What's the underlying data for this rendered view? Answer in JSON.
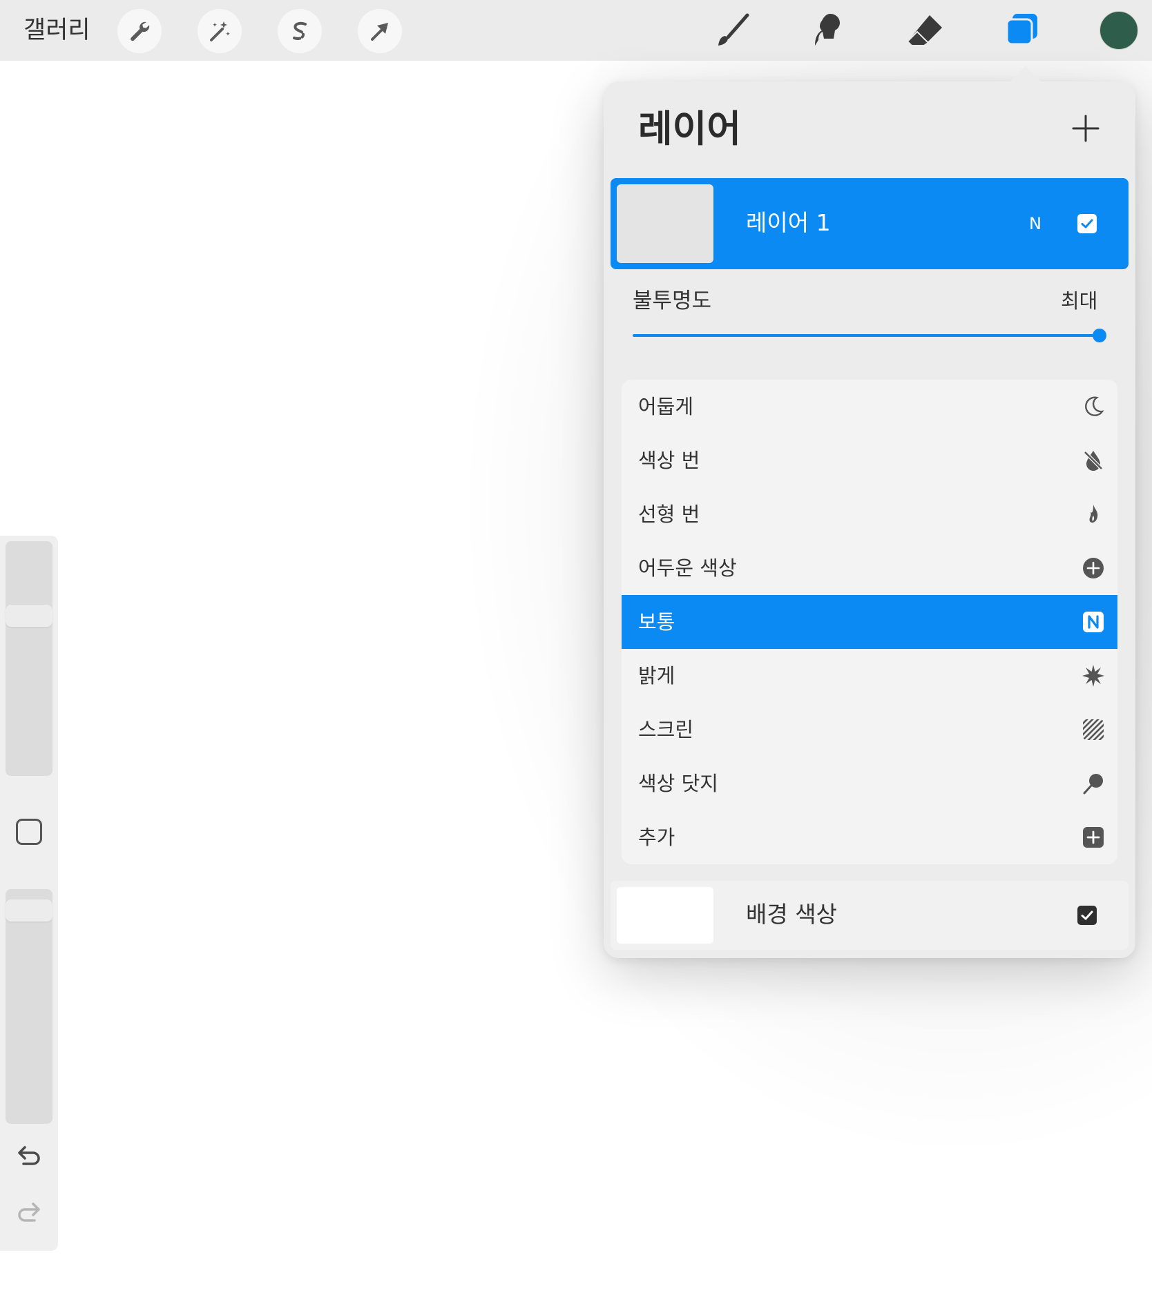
{
  "toolbar": {
    "gallery_label": "갤러리",
    "left_tools": [
      "wrench-icon",
      "magic-wand-icon",
      "selection-s-icon",
      "transform-arrow-icon"
    ],
    "right_tools": [
      "brush-icon",
      "smudge-icon",
      "eraser-icon",
      "layers-icon"
    ],
    "active_tool": "layers-icon",
    "current_color": "#2e5e4b"
  },
  "sidebar": {
    "brush_size_level": 0.7,
    "opacity_level": 0.95,
    "icons": [
      "modify-square-icon",
      "undo-icon",
      "redo-icon"
    ]
  },
  "layers_panel": {
    "title": "레이어",
    "add_icon": "plus-icon",
    "layer": {
      "name": "레이어 1",
      "blend_mode_short": "N",
      "visible": true
    },
    "opacity": {
      "label": "불투명도",
      "value_label": "최대",
      "level": 1.0
    },
    "blend_modes": [
      {
        "label": "어둡게",
        "icon": "moon-icon",
        "selected": false
      },
      {
        "label": "색상 번",
        "icon": "burn-drop-icon",
        "selected": false
      },
      {
        "label": "선형 번",
        "icon": "flame-icon",
        "selected": false
      },
      {
        "label": "어두운 색상",
        "icon": "plus-circle-icon",
        "selected": false
      },
      {
        "label": "보통",
        "icon": "n-badge-icon",
        "selected": true
      },
      {
        "label": "밝게",
        "icon": "sun-burst-icon",
        "selected": false
      },
      {
        "label": "스크린",
        "icon": "hatch-icon",
        "selected": false
      },
      {
        "label": "색상 닷지",
        "icon": "dodge-lollipop-icon",
        "selected": false
      },
      {
        "label": "추가",
        "icon": "plus-square-icon",
        "selected": false
      }
    ],
    "background": {
      "name": "배경 색상",
      "visible": true
    }
  },
  "colors": {
    "accent": "#0c8af3",
    "panel_bg": "#ececec",
    "toolbar_bg": "#ebebeb"
  }
}
